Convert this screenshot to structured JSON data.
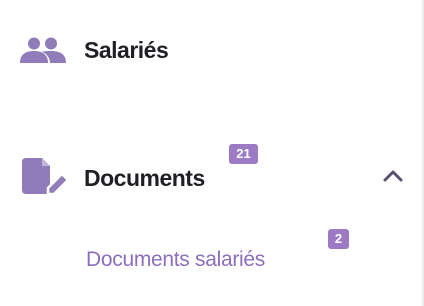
{
  "sidebar": {
    "items": [
      {
        "label": "Salariés",
        "icon": "people-icon"
      },
      {
        "label": "Documents",
        "icon": "document-edit-icon",
        "badge": "21",
        "expanded": true,
        "children": [
          {
            "label": "Documents salariés",
            "badge": "2"
          }
        ]
      }
    ]
  },
  "colors": {
    "text": "#1f2025",
    "icon": "#8f7cb8",
    "accent": "#8c6fbc",
    "badge": "#9c7bc4",
    "chevron": "#5a4f6e"
  }
}
